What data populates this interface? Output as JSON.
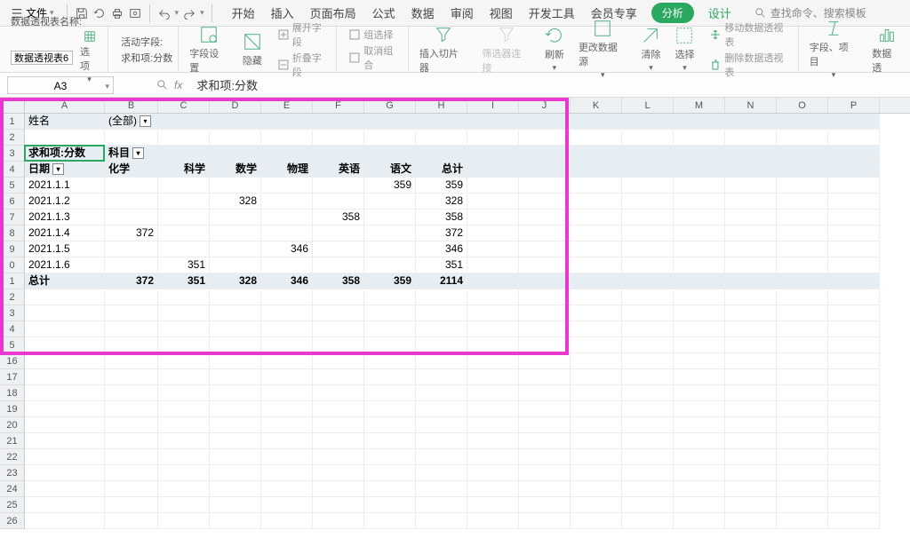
{
  "menu": {
    "label": "文件",
    "dropdown": "▾"
  },
  "tabs": [
    "开始",
    "插入",
    "页面布局",
    "公式",
    "数据",
    "审阅",
    "视图",
    "开发工具",
    "会员专享"
  ],
  "tab_analysis": "分析",
  "tab_design": "设计",
  "search_placeholder": "查找命令、搜索模板",
  "ribbon": {
    "pivot_name_label": "数据透视表名称:",
    "pivot_name_value": "数据透视表6",
    "options_label": "选项",
    "active_field_label": "活动字段:",
    "active_field_value": "求和项:分数",
    "field_settings": "字段设置",
    "hide": "隐藏",
    "expand": "展开字段",
    "collapse": "折叠字段",
    "group_sel": "组选择",
    "ungroup": "取消组合",
    "slicer": "插入切片器",
    "filter_link": "筛选器连接",
    "refresh": "刷新",
    "change_src": "更改数据源",
    "clear": "清除",
    "select": "选择",
    "move_pivot": "移动数据透视表",
    "del_pivot": "删除数据透视表",
    "fields_items": "字段、项目",
    "pivot_opt": "数据透"
  },
  "name_box": "A3",
  "formula": "求和项:分数",
  "columns": [
    "A",
    "B",
    "C",
    "D",
    "E",
    "F",
    "G",
    "H",
    "I",
    "J",
    "K",
    "L",
    "M",
    "N",
    "O",
    "P"
  ],
  "row_headers": [
    "1",
    "2",
    "3",
    "4",
    "5",
    "6",
    "7",
    "8",
    "9",
    "0",
    "1",
    "2",
    "3",
    "4",
    "5",
    "16",
    "17",
    "18",
    "19",
    "20",
    "21",
    "22",
    "23",
    "24",
    "25",
    "26"
  ],
  "pivot": {
    "filter_label": "姓名",
    "filter_value": "(全部)",
    "value_field": "求和项:分数",
    "col_field": "科目",
    "row_field": "日期",
    "col_labels": [
      "化学",
      "科学",
      "数学",
      "物理",
      "英语",
      "语文",
      "总计"
    ],
    "rows": [
      {
        "d": "2021.1.1",
        "v": [
          "",
          "",
          "",
          "",
          "",
          "359",
          "359"
        ]
      },
      {
        "d": "2021.1.2",
        "v": [
          "",
          "",
          "328",
          "",
          "",
          "",
          "328"
        ]
      },
      {
        "d": "2021.1.3",
        "v": [
          "",
          "",
          "",
          "",
          "358",
          "",
          "358"
        ]
      },
      {
        "d": "2021.1.4",
        "v": [
          "372",
          "",
          "",
          "",
          "",
          "",
          "372"
        ]
      },
      {
        "d": "2021.1.5",
        "v": [
          "",
          "",
          "",
          "346",
          "",
          "",
          "346"
        ]
      },
      {
        "d": "2021.1.6",
        "v": [
          "",
          "351",
          "",
          "",
          "",
          "",
          "351"
        ]
      }
    ],
    "total_label": "总计",
    "totals": [
      "372",
      "351",
      "328",
      "346",
      "358",
      "359",
      "2114"
    ]
  }
}
